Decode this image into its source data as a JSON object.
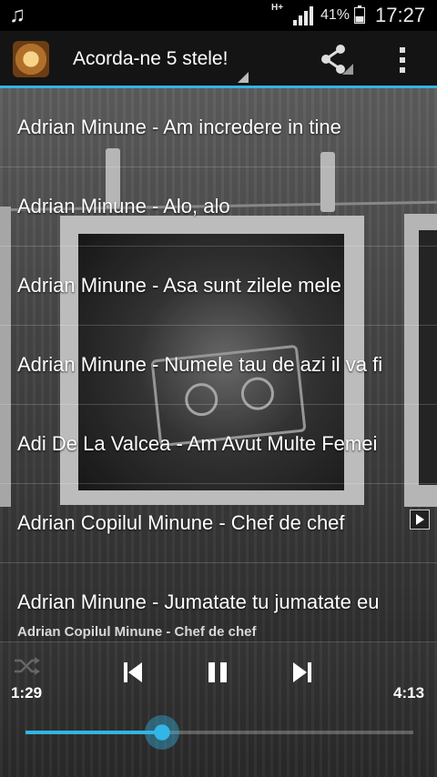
{
  "status_bar": {
    "network": "H+",
    "battery_percent": "41%",
    "battery_level": 0.41,
    "time": "17:27",
    "icons": [
      "music-note-icon",
      "signal-icon",
      "battery-icon"
    ]
  },
  "action_bar": {
    "title": "Acorda-ne 5 stele!",
    "icons": [
      "app-icon",
      "share-icon",
      "overflow-menu-icon"
    ]
  },
  "songs": [
    "Adrian Minune - Am incredere in tine",
    "Adrian Minune - Alo, alo",
    "Adrian Minune  - Asa sunt zilele mele",
    "Adrian Minune - Numele tau de azi il va fi",
    "Adi De La Valcea - Am Avut Multe Femei",
    "Adrian Copilul Minune - Chef de chef",
    "Adrian Minune - Jumatate tu jumatate eu"
  ],
  "player": {
    "now_playing": "Adrian Copilul Minune - Chef de chef",
    "elapsed": "1:29",
    "total": "4:13",
    "progress": 0.352,
    "icons": [
      "shuffle-icon",
      "previous-icon",
      "pause-icon",
      "next-icon"
    ]
  },
  "colors": {
    "accent": "#33b5e5",
    "action_bar": "#141414",
    "status_bar": "#000000"
  }
}
